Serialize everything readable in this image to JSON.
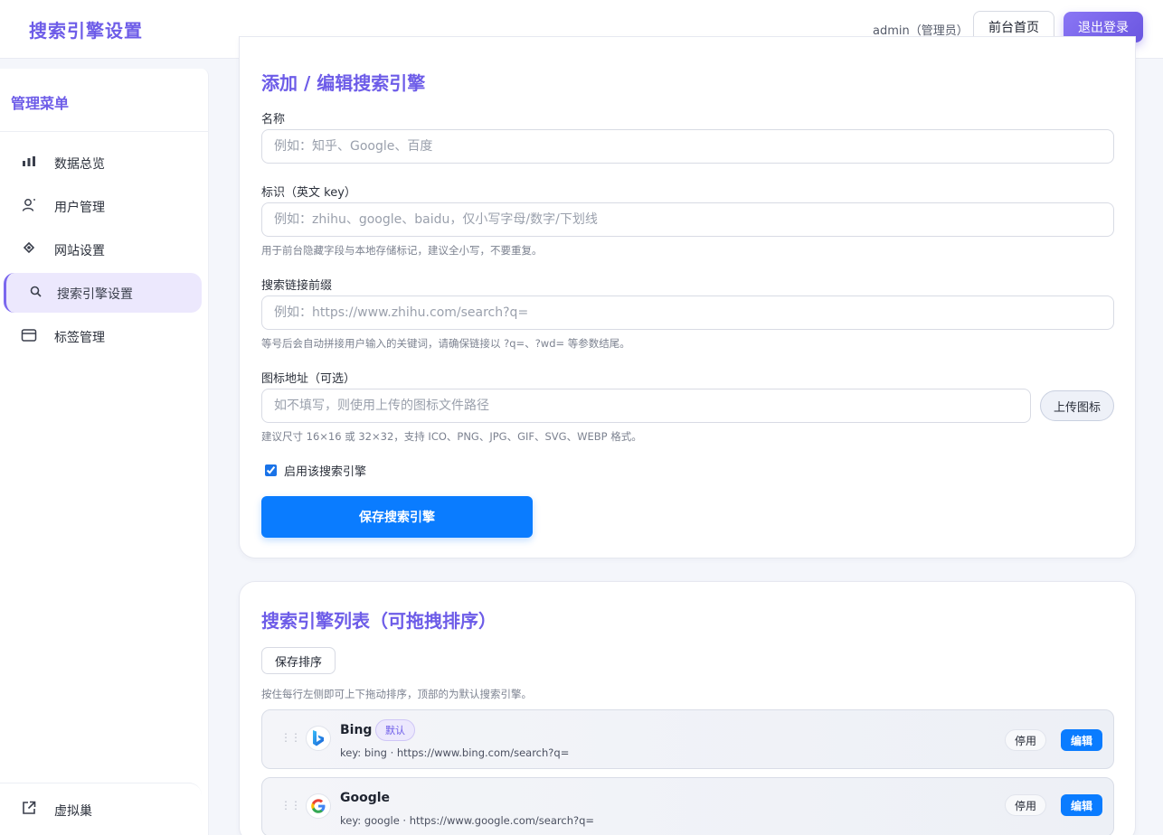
{
  "header": {
    "title": "搜索引擎设置",
    "user": "admin（管理员）",
    "home_label": "前台首页",
    "logout_label": "退出登录"
  },
  "sidebar": {
    "title": "管理菜单",
    "items": [
      {
        "label": "数据总览",
        "icon": "bar-chart-icon"
      },
      {
        "label": "用户管理",
        "icon": "user-icon"
      },
      {
        "label": "网站设置",
        "icon": "settings-icon"
      },
      {
        "label": "搜索引擎设置",
        "icon": "search-icon",
        "active": true
      },
      {
        "label": "标签管理",
        "icon": "tag-card-icon"
      }
    ],
    "bottom": {
      "label": "虚拟巢",
      "icon": "external-link-icon"
    }
  },
  "form": {
    "title": "添加 / 编辑搜索引擎",
    "name_label": "名称",
    "name_placeholder": "例如：知乎、Google、百度",
    "key_label": "标识（英文 key）",
    "key_placeholder": "例如：zhihu、google、baidu，仅小写字母/数字/下划线",
    "key_hint": "用于前台隐藏字段与本地存储标记，建议全小写，不要重复。",
    "url_label": "搜索链接前缀",
    "url_placeholder": "例如：https://www.zhihu.com/search?q=",
    "url_hint": "等号后会自动拼接用户输入的关键词，请确保链接以 ?q=、?wd= 等参数结尾。",
    "icon_label": "图标地址（可选）",
    "icon_placeholder": "如不填写，则使用上传的图标文件路径",
    "upload_label": "上传图标",
    "icon_hint": "建议尺寸 16×16 或 32×32，支持 ICO、PNG、JPG、GIF、SVG、WEBP 格式。",
    "enable_label": "启用该搜索引擎",
    "enabled": true,
    "save_label": "保存搜索引擎"
  },
  "list": {
    "title": "搜索引擎列表（可拖拽排序）",
    "save_sort_label": "保存排序",
    "hint": "按住每行左侧即可上下拖动排序，顶部的为默认搜索引擎。",
    "drag_glyph": "⋮⋮",
    "disable_label": "停用",
    "edit_label": "编辑",
    "engines": [
      {
        "name": "Bing",
        "badge": "默认",
        "meta": "key: bing · https://www.bing.com/search?q=",
        "icon": "bing-logo-icon"
      },
      {
        "name": "Google",
        "meta": "key: google · https://www.google.com/search?q=",
        "icon": "google-logo-icon"
      }
    ]
  },
  "colors": {
    "accent": "#6d5ce8",
    "primary": "#0a7cff"
  }
}
